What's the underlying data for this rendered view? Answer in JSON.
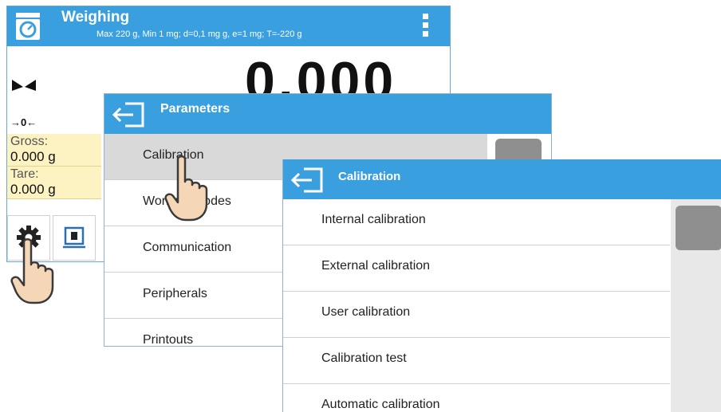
{
  "weighing": {
    "title": "Weighing",
    "subtitle": "Max 220 g, Min 1 mg; d=0,1 mg g, e=1 mg; T=-220 g",
    "reading": "0.000",
    "zero_indicator": "→0←",
    "gross_label": "Gross:",
    "gross_value": "0.000 g",
    "tare_label": "Tare:",
    "tare_value": "0.000 g",
    "header_color": "#3a9fde",
    "info_panel_color": "#fdf2c2"
  },
  "parameters": {
    "title": "Parameters",
    "items": [
      {
        "label": "Calibration",
        "selected": true
      },
      {
        "label": "Working modes",
        "selected": false
      },
      {
        "label": "Communication",
        "selected": false
      },
      {
        "label": "Peripherals",
        "selected": false
      },
      {
        "label": "Printouts",
        "selected": false
      }
    ]
  },
  "calibration": {
    "title": "Calibration",
    "items": [
      {
        "label": "Internal calibration"
      },
      {
        "label": "External calibration"
      },
      {
        "label": "User calibration"
      },
      {
        "label": "Calibration test"
      },
      {
        "label": "Automatic calibration"
      }
    ]
  },
  "icons": {
    "weighing_app": "scale-icon",
    "menu": "kebab-menu-icon",
    "stability": "stability-icon",
    "settings": "gear-icon",
    "profile": "weight-profile-icon",
    "back": "exit-icon",
    "pointer": "pointing-hand-icon"
  }
}
